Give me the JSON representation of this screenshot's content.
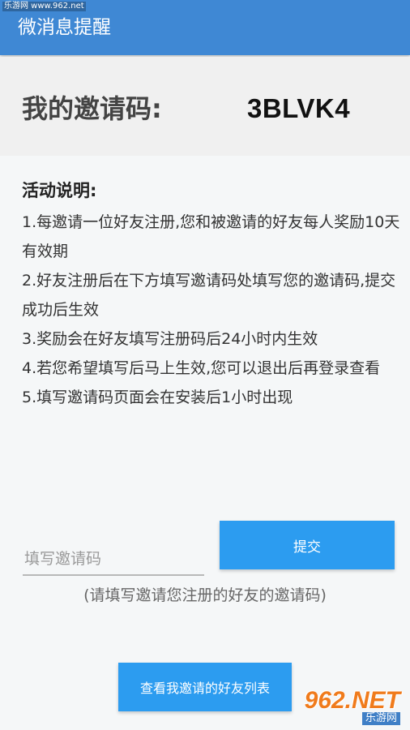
{
  "app": {
    "title": "微消息提醒",
    "watermark": "乐游网 www.962.net",
    "brand_color": "#3f88d4"
  },
  "invite": {
    "label": "我的邀请码:",
    "code": "3BLVK4"
  },
  "rules": {
    "title": "活动说明:",
    "items": [
      "1.每邀请一位好友注册,您和被邀请的好友每人奖励10天有效期",
      "2.好友注册后在下方填写邀请码处填写您的邀请码,提交成功后生效",
      "3.奖励会在好友填写注册码后24小时内生效",
      "4.若您希望填写后马上生效,您可以退出后再登录查看",
      "5.填写邀请码页面会在安装后1小时出现"
    ]
  },
  "form": {
    "placeholder": "填写邀请码",
    "value": "",
    "submit_label": "提交",
    "hint": "(请填写邀请您注册的好友的邀请码)",
    "button_color": "#2c9cf0"
  },
  "friends_button": {
    "label": "查看我邀请的好友列表"
  },
  "logo": {
    "main": "962.NET",
    "sub": "乐游网"
  }
}
